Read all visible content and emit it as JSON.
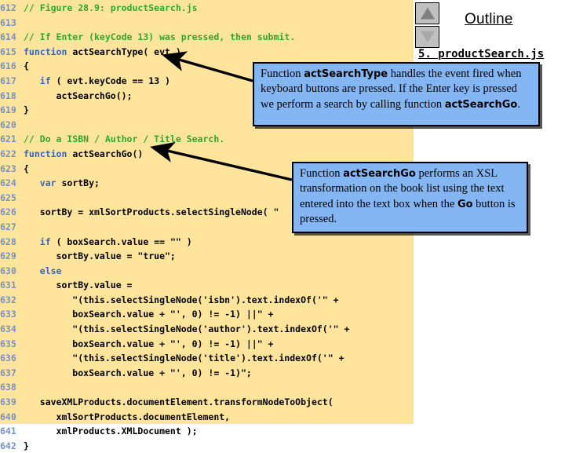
{
  "code_pane": {
    "language": "javascript",
    "background_color": "#FFE49B",
    "line_number_color": "#7691C4",
    "comment_color": "#2EA82E",
    "keyword_color": "#3465C4",
    "lines": [
      {
        "num": "612",
        "segments": [
          {
            "t": "// Figure 28.9: productSearch.js",
            "c": "cmt"
          }
        ]
      },
      {
        "num": "613",
        "segments": []
      },
      {
        "num": "614",
        "segments": [
          {
            "t": "// If Enter (keyCode 13) was pressed, then submit.",
            "c": "cmt"
          }
        ]
      },
      {
        "num": "615",
        "segments": [
          {
            "t": "function ",
            "c": "kw"
          },
          {
            "t": "actSearchType( evt )",
            "c": "idn"
          }
        ]
      },
      {
        "num": "616",
        "segments": [
          {
            "t": "{",
            "c": "idn"
          }
        ]
      },
      {
        "num": "617",
        "segments": [
          {
            "t": "   ",
            "c": "idn"
          },
          {
            "t": "if",
            "c": "kw"
          },
          {
            "t": " ( evt.keyCode == 13 )",
            "c": "idn"
          }
        ]
      },
      {
        "num": "618",
        "segments": [
          {
            "t": "      actSearchGo();",
            "c": "idn"
          }
        ]
      },
      {
        "num": "619",
        "segments": [
          {
            "t": "}",
            "c": "idn"
          }
        ]
      },
      {
        "num": "620",
        "segments": []
      },
      {
        "num": "621",
        "segments": [
          {
            "t": "// Do a ISBN / Author / Title Search.",
            "c": "cmt"
          }
        ]
      },
      {
        "num": "622",
        "segments": [
          {
            "t": "function ",
            "c": "kw"
          },
          {
            "t": "actSearchGo()",
            "c": "idn"
          }
        ]
      },
      {
        "num": "623",
        "segments": [
          {
            "t": "{",
            "c": "idn"
          }
        ]
      },
      {
        "num": "624",
        "segments": [
          {
            "t": "   ",
            "c": "idn"
          },
          {
            "t": "var",
            "c": "kw"
          },
          {
            "t": " sortBy;",
            "c": "idn"
          }
        ]
      },
      {
        "num": "625",
        "segments": []
      },
      {
        "num": "626",
        "segments": [
          {
            "t": "   sortBy = xmlSortProducts.selectSingleNode( \"",
            "c": "idn"
          }
        ]
      },
      {
        "num": "627",
        "segments": []
      },
      {
        "num": "628",
        "segments": [
          {
            "t": "   ",
            "c": "idn"
          },
          {
            "t": "if",
            "c": "kw"
          },
          {
            "t": " ( boxSearch.value == \"\" )",
            "c": "idn"
          }
        ]
      },
      {
        "num": "629",
        "segments": [
          {
            "t": "      sortBy.value = \"true\";",
            "c": "idn"
          }
        ]
      },
      {
        "num": "630",
        "segments": [
          {
            "t": "   ",
            "c": "idn"
          },
          {
            "t": "else",
            "c": "kw"
          }
        ]
      },
      {
        "num": "631",
        "segments": [
          {
            "t": "      sortBy.value =",
            "c": "idn"
          }
        ]
      },
      {
        "num": "632",
        "segments": [
          {
            "t": "         \"(this.selectSingleNode('isbn').text.indexOf('\" +",
            "c": "idn"
          }
        ]
      },
      {
        "num": "633",
        "segments": [
          {
            "t": "         boxSearch.value + \"', 0) != -1) ||\" +",
            "c": "idn"
          }
        ]
      },
      {
        "num": "634",
        "segments": [
          {
            "t": "         \"(this.selectSingleNode('author').text.indexOf('\" +",
            "c": "idn"
          }
        ]
      },
      {
        "num": "635",
        "segments": [
          {
            "t": "         boxSearch.value + \"', 0) != -1) ||\" +",
            "c": "idn"
          }
        ]
      },
      {
        "num": "636",
        "segments": [
          {
            "t": "         \"(this.selectSingleNode('title').text.indexOf('\" +",
            "c": "idn"
          }
        ]
      },
      {
        "num": "637",
        "segments": [
          {
            "t": "         boxSearch.value + \"', 0) != -1)\";",
            "c": "idn"
          }
        ]
      },
      {
        "num": "638",
        "segments": []
      },
      {
        "num": "639",
        "segments": [
          {
            "t": "   saveXMLProducts.documentElement.transformNodeToObject(",
            "c": "idn"
          }
        ]
      },
      {
        "num": "640",
        "segments": [
          {
            "t": "      xmlSortProducts.documentElement,",
            "c": "idn"
          }
        ]
      },
      {
        "num": "641",
        "segments": [
          {
            "t": "      xmlProducts.XMLDocument );",
            "c": "idn"
          }
        ]
      },
      {
        "num": "642",
        "segments": [
          {
            "t": "}",
            "c": "idn"
          }
        ]
      }
    ]
  },
  "outline": {
    "title": "Outline",
    "entry": "5. productSearch.js",
    "spinner_up_icon": "triangle-up-icon",
    "spinner_down_icon": "triangle-down-icon"
  },
  "callouts": [
    {
      "id": "callout-search-type",
      "html": "Function <b>actSearchType</b> handles the event fired when keyboard buttons are pressed. If the Enter key is pressed we perform a search by calling function <b>actSearchGo</b>.",
      "text": "Function actSearchType handles the event fired when keyboard buttons are pressed. If the Enter key is pressed we perform a search by calling function actSearchGo.",
      "background_color": "#84B6F4",
      "points_to_line": "615"
    },
    {
      "id": "callout-search-go",
      "html": "Function <b>actSearchGo</b> performs an XSL transformation on the book list using the text entered into the text box when the <b>Go</b> button is pressed.",
      "text": "Function actSearchGo performs an XSL transformation on the book list using the text entered into the text box when the Go button is pressed.",
      "background_color": "#84B6F4",
      "points_to_line": "622"
    }
  ]
}
